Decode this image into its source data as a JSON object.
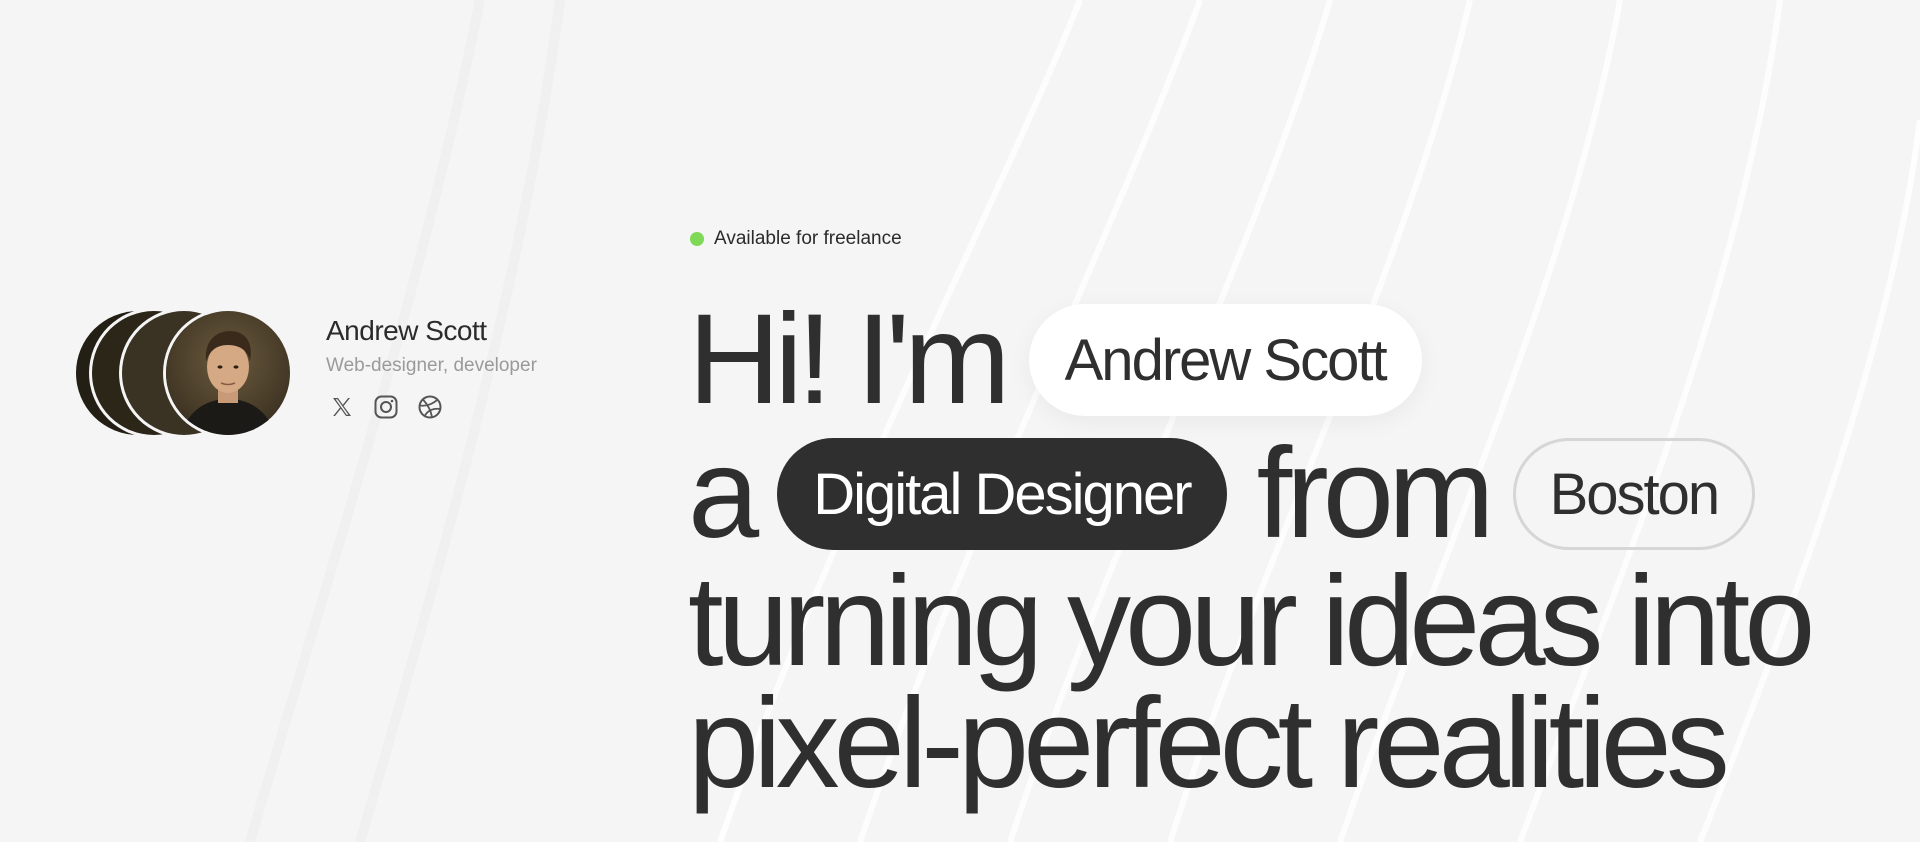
{
  "profile": {
    "name": "Andrew Scott",
    "role": "Web-designer, developer",
    "socials": [
      "x-icon",
      "instagram-icon",
      "dribbble-icon"
    ]
  },
  "status": {
    "text": "Available for freelance",
    "dot_color": "#7ed957"
  },
  "headline": {
    "greeting": "Hi! I'm",
    "name_pill": "Andrew Scott",
    "article": "a",
    "role_pill": "Digital Designer",
    "from": "from",
    "city_pill": "Boston",
    "line3": "turning your ideas into",
    "line4": "pixel-perfect realities"
  },
  "colors": {
    "background": "#f5f5f5",
    "text": "#2f2f2f",
    "dark_pill": "#2f2f2f",
    "light_pill": "#ffffff",
    "muted": "#9a9a9a"
  }
}
